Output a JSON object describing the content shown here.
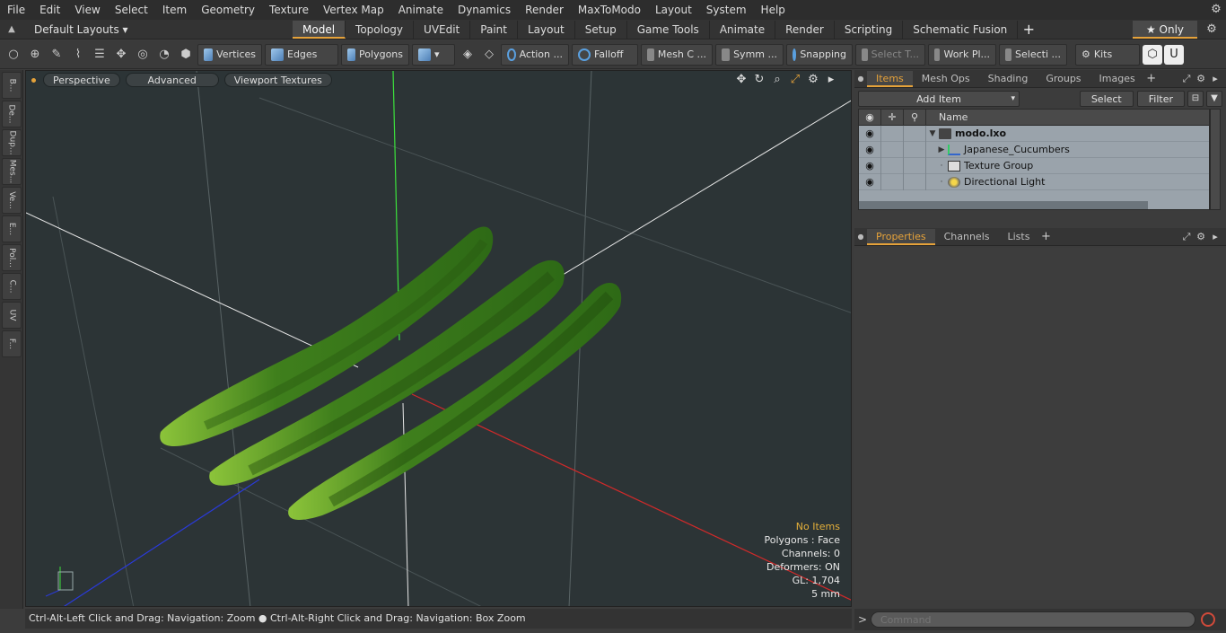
{
  "menubar": {
    "items": [
      "File",
      "Edit",
      "View",
      "Select",
      "Item",
      "Geometry",
      "Texture",
      "Vertex Map",
      "Animate",
      "Dynamics",
      "Render",
      "MaxToModo",
      "Layout",
      "System",
      "Help"
    ]
  },
  "layoutrow": {
    "layouts_label": "Default Layouts ▾",
    "tabs": [
      "Model",
      "Topology",
      "UVEdit",
      "Paint",
      "Layout",
      "Setup",
      "Game Tools",
      "Animate",
      "Render",
      "Scripting",
      "Schematic Fusion"
    ],
    "active_tab": "Model",
    "only_label": "★ Only"
  },
  "toolbar": {
    "vertices": "Vertices",
    "edges": "Edges",
    "polygons": "Polygons",
    "action": "Action ...",
    "falloff": "Falloff",
    "mesh_c": "Mesh C ...",
    "symm": "Symm ...",
    "snapping": "Snapping",
    "select_t": "Select T...",
    "work_pl": "Work Pl...",
    "selecti": "Selecti ...",
    "kits": "Kits"
  },
  "lefttabs": [
    "B...",
    "De...",
    "Dup...",
    "Mes...",
    "Ve...",
    "E...",
    "Pol...",
    "C...",
    "UV",
    "F..."
  ],
  "viewport": {
    "perspective": "Perspective",
    "advanced": "Advanced",
    "viewport_textures": "Viewport Textures",
    "info": {
      "no_items": "No Items",
      "polygons": "Polygons : Face",
      "channels": "Channels: 0",
      "deformers": "Deformers: ON",
      "gl": "GL: 1,704",
      "scale": "5 mm"
    }
  },
  "statusbar": {
    "text": "Ctrl-Alt-Left Click and Drag: Navigation: Zoom ● Ctrl-Alt-Right Click and Drag: Navigation: Box Zoom"
  },
  "items_panel": {
    "tabs": [
      "Items",
      "Mesh Ops",
      "Shading",
      "Groups",
      "Images"
    ],
    "active_tab": "Items",
    "add_item": "Add Item",
    "select": "Select",
    "filter": "Filter",
    "name_header": "Name",
    "rows": [
      {
        "label": "modo.lxo",
        "bold": true
      },
      {
        "label": "Japanese_Cucumbers",
        "bold": false
      },
      {
        "label": "Texture Group",
        "bold": false
      },
      {
        "label": "Directional Light",
        "bold": false
      }
    ]
  },
  "props_panel": {
    "tabs": [
      "Properties",
      "Channels",
      "Lists"
    ],
    "active_tab": "Properties"
  },
  "command": {
    "placeholder": "Command"
  }
}
